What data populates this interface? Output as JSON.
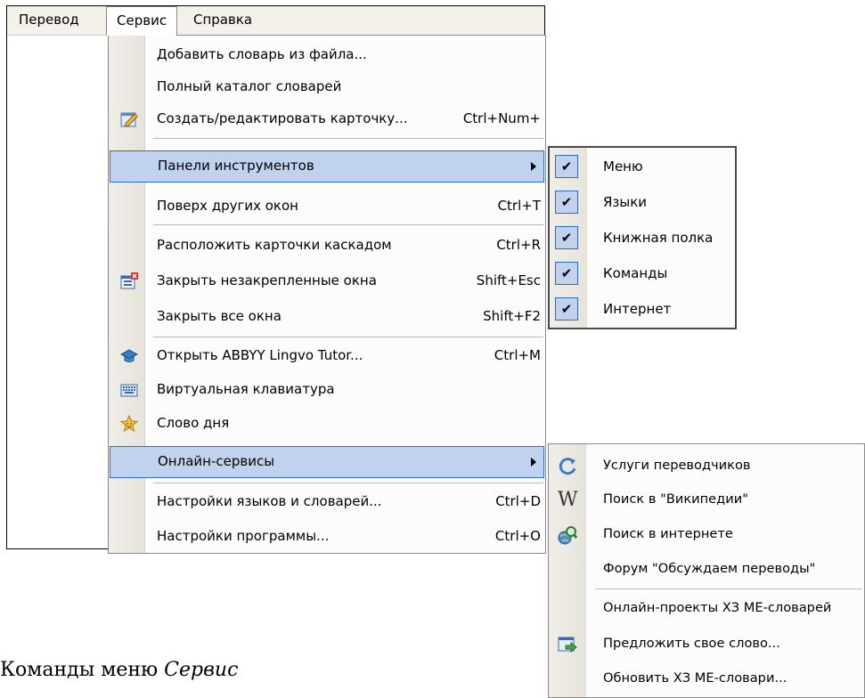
{
  "menubar": {
    "items": [
      "Перевод",
      "Сервис",
      "Справка"
    ]
  },
  "service_menu": {
    "items": [
      {
        "label": "Добавить словарь из файла...",
        "shortcut": ""
      },
      {
        "label": "Полный каталог словарей",
        "shortcut": ""
      },
      {
        "label": "Создать/редактировать карточку...",
        "shortcut": "Ctrl+Num+",
        "icon": "edit-card-icon"
      },
      {
        "label": "Панели инструментов",
        "shortcut": ""
      },
      {
        "label": "Поверх других окон",
        "shortcut": "Ctrl+T"
      },
      {
        "label": "Расположить карточки каскадом",
        "shortcut": "Ctrl+R"
      },
      {
        "label": "Закрыть незакрепленные окна",
        "shortcut": "Shift+Esc",
        "icon": "close-windows-icon"
      },
      {
        "label": "Закрыть все окна",
        "shortcut": "Shift+F2"
      },
      {
        "label": "Открыть ABBYY Lingvo Tutor...",
        "shortcut": "Ctrl+M",
        "icon": "graduation-cap-icon"
      },
      {
        "label": "Виртуальная клавиатура",
        "shortcut": "",
        "icon": "keyboard-icon"
      },
      {
        "label": "Слово дня",
        "shortcut": "",
        "icon": "star-icon"
      },
      {
        "label": "Онлайн-сервисы",
        "shortcut": ""
      },
      {
        "label": "Настройки языков и словарей...",
        "shortcut": "Ctrl+D"
      },
      {
        "label": "Настройки программы...",
        "shortcut": "Ctrl+O"
      }
    ]
  },
  "toolbars_submenu": {
    "checkmark": "✔",
    "items": [
      "Меню",
      "Языки",
      "Книжная полка",
      "Команды",
      "Интернет"
    ]
  },
  "online_submenu": {
    "items": [
      {
        "label": "Услуги переводчиков",
        "icon": "translator-services-icon"
      },
      {
        "label": "Поиск в \"Википедии\"",
        "icon": "wikipedia-icon"
      },
      {
        "label": "Поиск в интернете",
        "icon": "web-search-icon"
      },
      {
        "label": "Форум \"Обсуждаем переводы\""
      },
      {
        "label": "Онлайн-проекты ХЗ МЕ-словарей"
      },
      {
        "label": "Предложить свое слово...",
        "icon": "suggest-word-icon"
      },
      {
        "label": "Обновить ХЗ МЕ-словари..."
      }
    ]
  },
  "caption": {
    "text": "Команды меню ",
    "emph": "Сервис"
  }
}
